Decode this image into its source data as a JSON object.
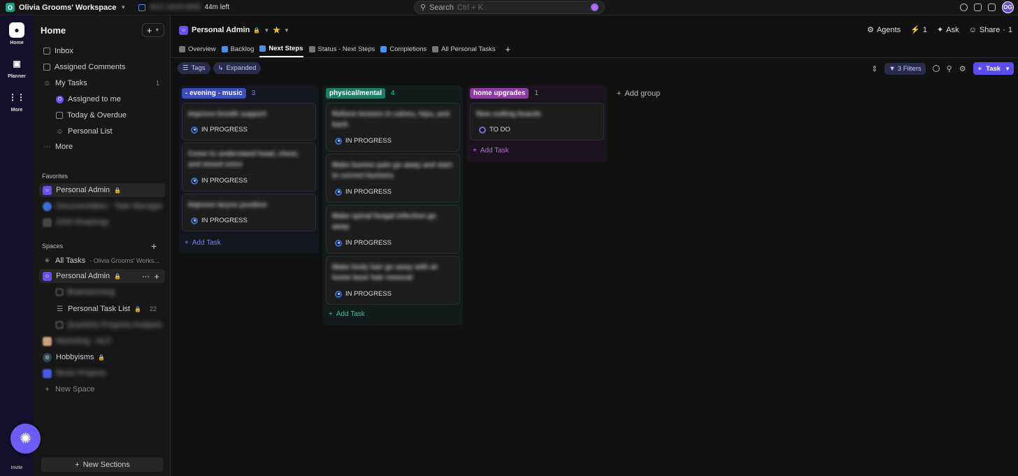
{
  "topbar": {
    "workspace_initial": "O",
    "workspace_name": "Olivia Grooms' Workspace",
    "timer_hidden": "ACC-2024-0000",
    "timer_left": "44m left",
    "search_placeholder": "Search",
    "search_shortcut": "Ctrl + K",
    "avatar_initials": "OG"
  },
  "rail": {
    "home": "Home",
    "planner": "Planner",
    "more": "More",
    "invite": "Invite"
  },
  "sidebar": {
    "title": "Home",
    "items": {
      "inbox": "Inbox",
      "assigned_comments": "Assigned Comments",
      "my_tasks": "My Tasks",
      "my_tasks_count": "1",
      "assigned_to_me": "Assigned to me",
      "today_overdue": "Today & Overdue",
      "personal_list": "Personal List",
      "more": "More"
    },
    "favorites_label": "Favorites",
    "favorites": [
      "Personal Admin",
      "Documentation - Task Manager",
      "2025 Roadmap"
    ],
    "spaces_label": "Spaces",
    "all_tasks": "All Tasks",
    "all_tasks_sub": "- Olivia Grooms' Works...",
    "space_personal_admin": "Personal Admin",
    "space_children": [
      "Brainstorming",
      "Personal Task List",
      "Quarterly Progress Analysis"
    ],
    "personal_task_list_count": "22",
    "other_spaces": [
      "Marketing - ALD",
      "Hobbyisms",
      "Music Projects"
    ],
    "new_space": "New Space",
    "new_sections": "New Sections"
  },
  "header": {
    "crumb": "Personal Admin",
    "agents": "Agents",
    "bolt_count": "1",
    "ask": "Ask",
    "share": "Share",
    "share_count": "1"
  },
  "tabs": [
    "Overview",
    "Backlog",
    "Next Steps",
    "Status - Next Steps",
    "Completions",
    "All Personal Tasks"
  ],
  "toolbar": {
    "tags": "Tags",
    "expanded": "Expanded",
    "filters": "3 Filters",
    "task": "Task"
  },
  "board": {
    "add_group": "Add group",
    "add_task": "Add Task",
    "columns": [
      {
        "name": "- evening - music",
        "count": "3",
        "color": "#3b4db8",
        "text_color": "#6f86ff",
        "cards": [
          {
            "title": "Improve breath support",
            "status": "IN PROGRESS"
          },
          {
            "title": "Come to understand head, chest, and mixed voice",
            "status": "IN PROGRESS"
          },
          {
            "title": "Improve larynx position",
            "status": "IN PROGRESS"
          }
        ]
      },
      {
        "name": "physical/mental",
        "count": "4",
        "color": "#1f7a66",
        "text_color": "#33c4a0",
        "cards": [
          {
            "title": "Relieve tension in calves, hips, and back",
            "status": "IN PROGRESS"
          },
          {
            "title": "Make bunion pain go away and start to correct bunions",
            "status": "IN PROGRESS"
          },
          {
            "title": "Make spinal fungal infection go away",
            "status": "IN PROGRESS"
          },
          {
            "title": "Make body hair go away with at-home laser hair removal",
            "status": "IN PROGRESS"
          }
        ]
      },
      {
        "name": "home upgrades",
        "count": "1",
        "color": "#8a3d9e",
        "text_color": "#c06ad8",
        "cards": [
          {
            "title": "New cutting boards",
            "status": "TO DO"
          }
        ]
      }
    ]
  }
}
